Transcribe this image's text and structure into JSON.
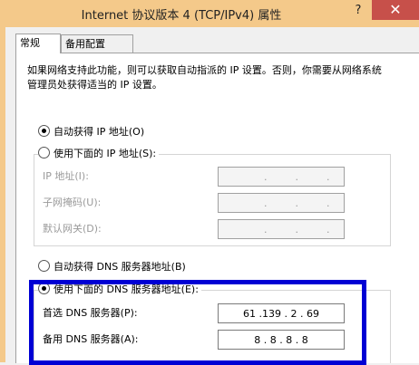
{
  "window": {
    "title": "Internet 协议版本 4 (TCP/IPv4) 属性",
    "help": "?",
    "close": "✕"
  },
  "tabs": [
    {
      "label": "常规"
    },
    {
      "label": "备用配置"
    }
  ],
  "description": "如果网络支持此功能，则可以获取自动指派的 IP 设置。否则，你需要从网络系统管理员处获得适当的 IP 设置。",
  "ip": {
    "auto_label": "自动获得 IP 地址(O)",
    "manual_label": "使用下面的 IP 地址(S):",
    "fields": [
      {
        "label": "IP 地址(I):",
        "octets": [
          "",
          ".",
          ".",
          "."
        ]
      },
      {
        "label": "子网掩码(U):",
        "octets": [
          "",
          ".",
          ".",
          "."
        ]
      },
      {
        "label": "默认网关(D):",
        "octets": [
          "",
          ".",
          ".",
          "."
        ]
      }
    ]
  },
  "dns": {
    "auto_label": "自动获得 DNS 服务器地址(B)",
    "manual_label": "使用下面的 DNS 服务器地址(E):",
    "preferred_label": "首选 DNS 服务器(P):",
    "preferred_value": "61 .139 . 2 . 69",
    "alternate_label": "备用 DNS 服务器(A):",
    "alternate_value": "8 . 8 . 8 . 8"
  },
  "colors": {
    "title_bar": "#f4c98a",
    "close_button": "#c7504a",
    "highlight": "#0000d4"
  }
}
